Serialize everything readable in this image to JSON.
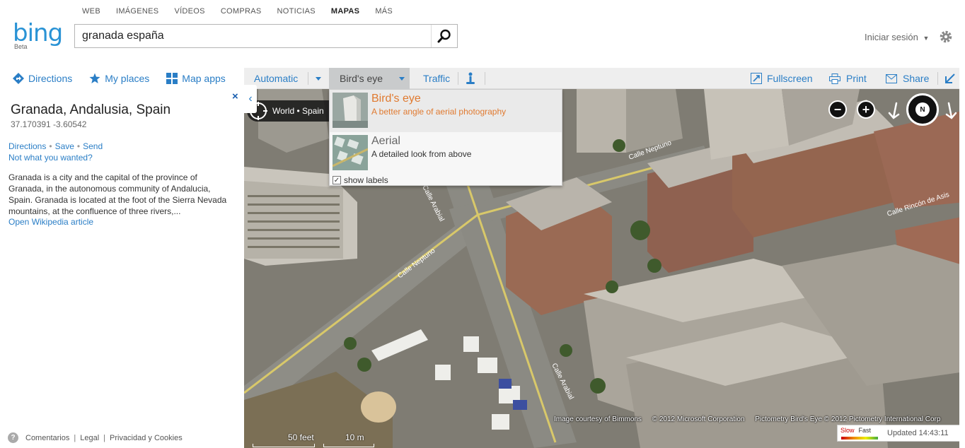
{
  "topnav": {
    "items": [
      "WEB",
      "IMÁGENES",
      "VÍDEOS",
      "COMPRAS",
      "NOTICIAS",
      "MAPAS",
      "MÁS"
    ],
    "active": "MAPAS"
  },
  "logo": {
    "word": "bing",
    "badge": "Beta"
  },
  "search": {
    "value": "granada españa"
  },
  "account": {
    "signin": "Iniciar sesión"
  },
  "toolbar": {
    "directions": "Directions",
    "my_places": "My places",
    "map_apps": "Map apps",
    "automatic": "Automatic",
    "birds_eye": "Bird's eye",
    "traffic": "Traffic",
    "fullscreen": "Fullscreen",
    "print": "Print",
    "share": "Share"
  },
  "result": {
    "title": "Granada, Andalusia, Spain",
    "coords": "37.170391 -3.60542",
    "actions": [
      "Directions",
      "Save",
      "Send"
    ],
    "not_what": "Not what you wanted?",
    "description": "Granada is a city and the capital of the province of Granada, in the autonomous community of Andalucia, Spain. Granada is located at the foot of the Sierra Nevada mountains, at the confluence of three rivers,...",
    "wiki_link": "Open Wikipedia article"
  },
  "footer": {
    "items": [
      "Comentarios",
      "Legal",
      "Privacidad y Cookies"
    ]
  },
  "map": {
    "breadcrumb": "World • Spain",
    "streets": [
      "Calle Neptuno",
      "Calle Neptuno",
      "Calle Arabial",
      "Calle Arabial",
      "Calle Rincón de Asis",
      "ca"
    ],
    "credits": [
      "Image courtesy of Bimmons",
      "© 2012 Microsoft Corporation",
      "Pictometry Bird's Eye © 2012 Pictometry International Corp"
    ],
    "scale": {
      "imperial": "50 feet",
      "metric": "10 m"
    },
    "traffic_legend": {
      "slow": "Slow",
      "fast": "Fast",
      "updated": "Updated 14:43:11"
    },
    "compass": "N"
  },
  "dropdown": {
    "options": [
      {
        "name": "Bird's eye",
        "desc": "A better angle of aerial photography",
        "selected": true
      },
      {
        "name": "Aerial",
        "desc": "A detailed look from above",
        "selected": false
      }
    ],
    "show_labels": "show labels",
    "show_labels_checked": true
  },
  "colors": {
    "accent": "#2a7ec6",
    "selected": "#e07a30",
    "logo": "#2a93d5"
  }
}
